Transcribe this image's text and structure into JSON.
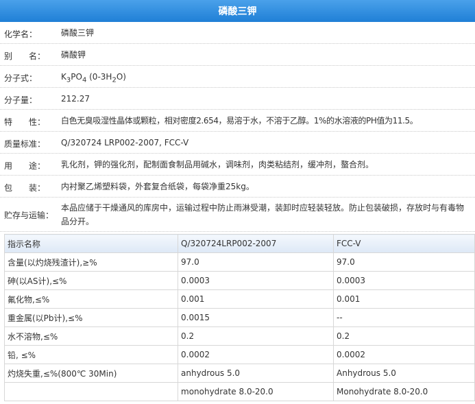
{
  "title": "磷酸三钾",
  "properties": [
    {
      "label": "化学名：",
      "value": "磷酸三钾"
    },
    {
      "label": "别　　名：",
      "value": "磷酸钾"
    },
    {
      "label": "分子式：",
      "value": "K3PO4 (0-3H2O)"
    },
    {
      "label": "分子量：",
      "value": "212.27"
    },
    {
      "label": "特　　性：",
      "value": "白色无臭吸湿性晶体或颗粒，相对密度2.654，易溶于水，不溶于乙醇。1%的水溶液的PH值为11.5。"
    },
    {
      "label": "质量标准：",
      "value": "Q/320724 LRP002-2007, FCC-V"
    },
    {
      "label": "用　　途：",
      "value": "乳化剂，钾的强化剂，配制面食制品用碱水，调味剂，肉类粘结剂，缓冲剂，螯合剂。"
    },
    {
      "label": "包　　装：",
      "value": "内衬聚乙烯塑料袋，外套复合纸袋，每袋净重25kg。"
    },
    {
      "label": "贮存与运输：",
      "value": "本品应储于干燥通风的库房中，运输过程中防止雨淋受潮，装卸时应轻装轻放。防止包装破损，存放时与有毒物品分开。"
    }
  ],
  "formula_parts": {
    "k": "K",
    "k_sub": "3",
    "po": "PO",
    "po_sub": "4",
    "paren_open": " (0-3H",
    "h_sub": "2",
    "paren_close": "O)"
  },
  "spec_table": {
    "headers": [
      "指示名称",
      "Q/320724LRP002-2007",
      "FCC-V"
    ],
    "rows": [
      [
        "含量(以灼烧残渣计),≥%",
        "97.0",
        "97.0"
      ],
      [
        "砷(以AS计),≤%",
        "0.0003",
        "0.0003"
      ],
      [
        "氟化物,≤%",
        "0.001",
        "0.001"
      ],
      [
        "重金属(以Pb计),≤%",
        "0.0015",
        "--"
      ],
      [
        "水不溶物,≤%",
        "0.2",
        "0.2"
      ],
      [
        "铅, ≤%",
        "0.0002",
        "0.0002"
      ],
      [
        "灼烧失重,≤%(800℃ 30Min)",
        "anhydrous 5.0",
        "Anhydrous 5.0"
      ],
      [
        "",
        "monohydrate 8.0-20.0",
        "Monohydrate 8.0-20.0"
      ]
    ]
  }
}
